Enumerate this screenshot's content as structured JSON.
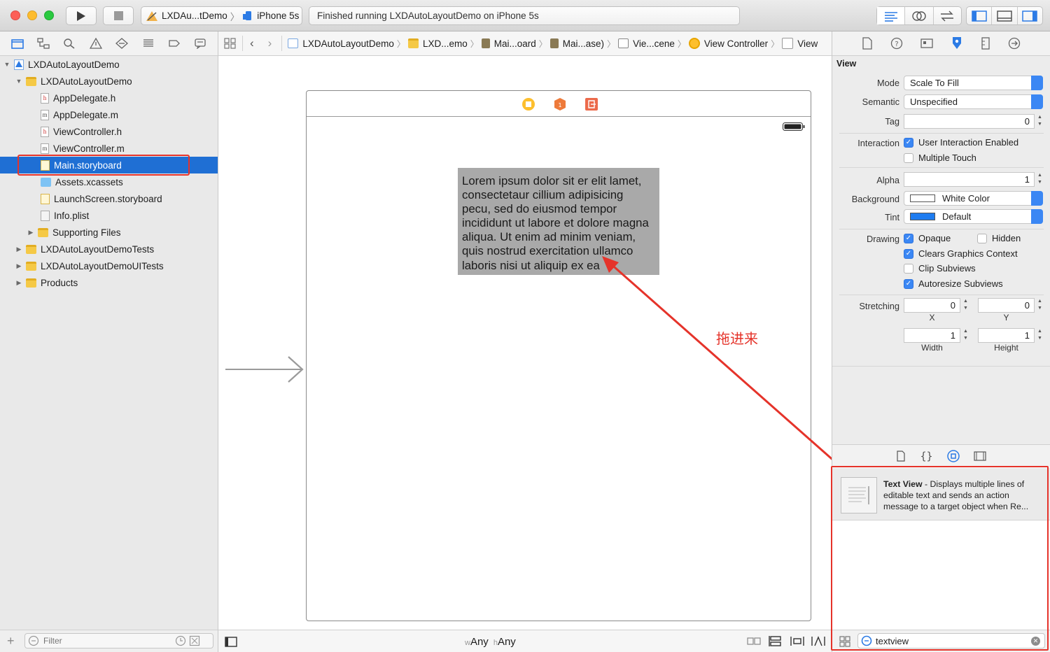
{
  "toolbar": {
    "scheme": "LXDAu...tDemo",
    "device": "iPhone 5s",
    "status": "Finished running LXDAutoLayoutDemo on iPhone 5s"
  },
  "navigator": {
    "items": [
      {
        "label": "LXDAutoLayoutDemo",
        "icon": "project-icon",
        "disclosure": "open"
      },
      {
        "label": "LXDAutoLayoutDemo",
        "icon": "folder-icon",
        "disclosure": "open"
      },
      {
        "label": "AppDelegate.h",
        "icon": "header-file-icon",
        "glyph": "h"
      },
      {
        "label": "AppDelegate.m",
        "icon": "source-file-icon",
        "glyph": "m"
      },
      {
        "label": "ViewController.h",
        "icon": "header-file-icon",
        "glyph": "h"
      },
      {
        "label": "ViewController.m",
        "icon": "source-file-icon",
        "glyph": "m"
      },
      {
        "label": "Main.storyboard",
        "icon": "storyboard-icon",
        "selected": true
      },
      {
        "label": "Assets.xcassets",
        "icon": "assets-icon"
      },
      {
        "label": "LaunchScreen.storyboard",
        "icon": "storyboard-icon"
      },
      {
        "label": "Info.plist",
        "icon": "plist-icon"
      },
      {
        "label": "Supporting Files",
        "icon": "folder-icon",
        "disclosure": "closed"
      },
      {
        "label": "LXDAutoLayoutDemoTests",
        "icon": "folder-icon",
        "disclosure": "closed"
      },
      {
        "label": "LXDAutoLayoutDemoUITests",
        "icon": "folder-icon",
        "disclosure": "closed"
      },
      {
        "label": "Products",
        "icon": "folder-icon",
        "disclosure": "closed"
      }
    ],
    "filter_placeholder": "Filter"
  },
  "jumpbar": {
    "crumbs": [
      "LXDAutoLayoutDemo",
      "LXD...emo",
      "Mai...oard",
      "Mai...ase)",
      "Vie...cene",
      "View Controller",
      "View"
    ]
  },
  "canvas": {
    "text_view_content": "Lorem ipsum dolor sit er elit lamet, consectetaur cillium adipisicing pecu, sed do eiusmod tempor incididunt ut labore et dolore magna aliqua. Ut enim ad minim veniam, quis nostrud exercitation ullamco laboris nisi ut aliquip ex ea",
    "annotation": "拖进来",
    "size_class_w_prefix": "w",
    "size_class_w": "Any",
    "size_class_h_prefix": "h",
    "size_class_h": "Any"
  },
  "inspector": {
    "section": "View",
    "mode_label": "Mode",
    "mode_value": "Scale To Fill",
    "semantic_label": "Semantic",
    "semantic_value": "Unspecified",
    "tag_label": "Tag",
    "tag_value": "0",
    "interaction_label": "Interaction",
    "user_interaction": "User Interaction Enabled",
    "multiple_touch": "Multiple Touch",
    "alpha_label": "Alpha",
    "alpha_value": "1",
    "background_label": "Background",
    "background_value": "White Color",
    "tint_label": "Tint",
    "tint_value": "Default",
    "drawing_label": "Drawing",
    "opaque": "Opaque",
    "hidden": "Hidden",
    "clears_graphics": "Clears Graphics Context",
    "clip_subviews": "Clip Subviews",
    "autoresize_subviews": "Autoresize Subviews",
    "stretching_label": "Stretching",
    "stretch_x": "0",
    "stretch_y": "0",
    "stretch_w": "1",
    "stretch_h": "1",
    "x_label": "X",
    "y_label": "Y",
    "width_label": "Width",
    "height_label": "Height",
    "checks": {
      "user_interaction": true,
      "multiple_touch": false,
      "opaque": true,
      "hidden": false,
      "clears_graphics": true,
      "clip_subviews": false,
      "autoresize_subviews": true
    }
  },
  "library": {
    "item_title": "Text View",
    "item_desc": " - Displays multiple lines of editable text and sends an action message to a target object when Re...",
    "search_value": "textview"
  },
  "colors": {
    "selection": "#1f6fd4",
    "annotation_red": "#e5332a",
    "accent": "#3b87f4",
    "textview_bg": "#a9a9a9"
  }
}
